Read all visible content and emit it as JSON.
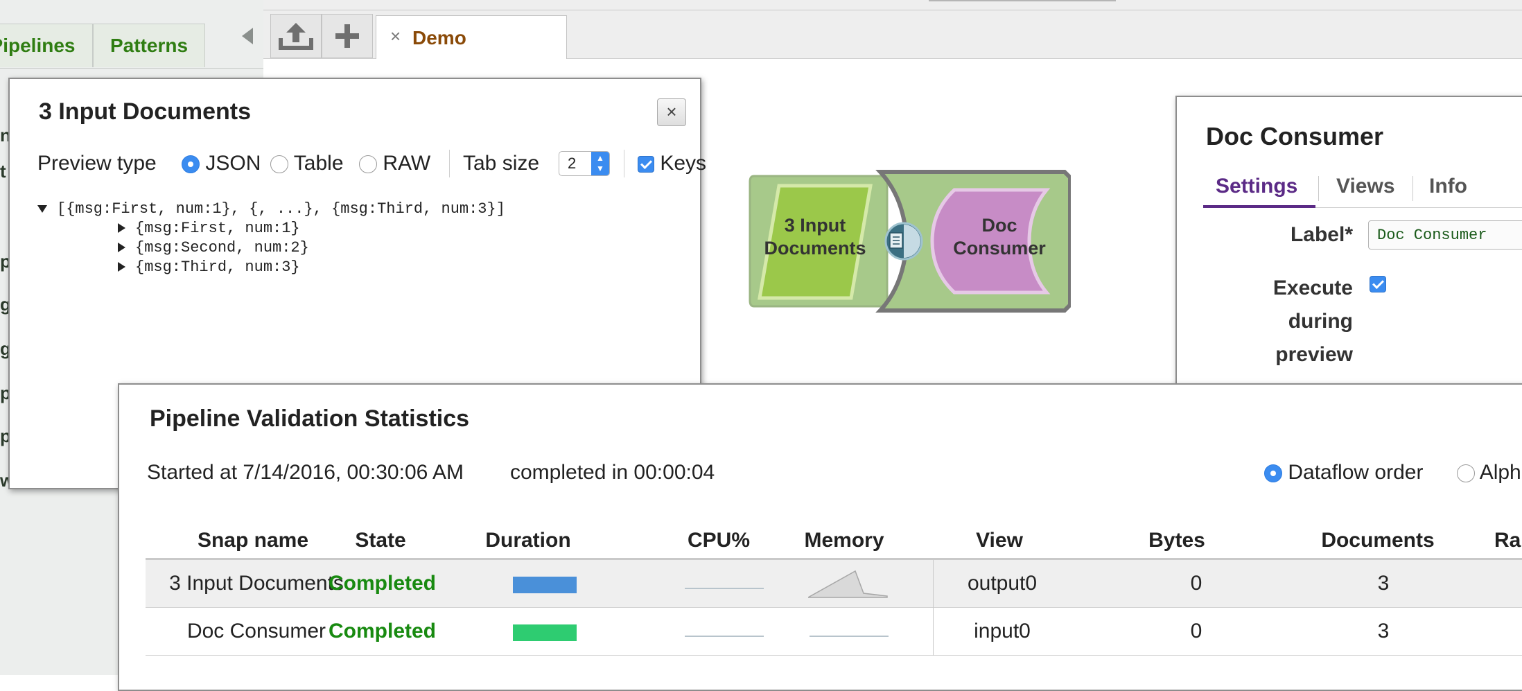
{
  "sidebar": {
    "tabs": [
      {
        "label": "Pipelines"
      },
      {
        "label": "Patterns"
      }
    ],
    "fragments": [
      "n",
      "t",
      "p",
      "g",
      "g",
      "p",
      "p",
      "w"
    ]
  },
  "topbar": {
    "tab_title": "Demo",
    "close_glyph": "×"
  },
  "preview": {
    "title": "3 Input Documents",
    "close_glyph": "×",
    "preview_type_label": "Preview type",
    "options": [
      "JSON",
      "Table",
      "RAW"
    ],
    "selected": "JSON",
    "tab_size_label": "Tab size",
    "tab_size_value": "2",
    "keys_label": "Keys",
    "keys_checked": true,
    "tree_root": "[{msg:First, num:1}, {, ...}, {msg:Third, num:3}]",
    "tree_children": [
      "{msg:First, num:1}",
      "{msg:Second, num:2}",
      "{msg:Third, num:3}"
    ]
  },
  "pipeline": {
    "nodes": [
      {
        "label_line1": "3 Input",
        "label_line2": "Documents",
        "color": "#9bc84a"
      },
      {
        "label_line1": "Doc",
        "label_line2": "Consumer",
        "color": "#c78cc6"
      }
    ]
  },
  "settings": {
    "title": "Doc Consumer",
    "tabs": [
      "Settings",
      "Views",
      "Info"
    ],
    "active_tab": "Settings",
    "label_caption": "Label*",
    "label_value": "Doc Consumer",
    "execute_caption_lines": [
      "Execute",
      "during",
      "preview"
    ],
    "execute_checked": true
  },
  "stats": {
    "title": "Pipeline Validation Statistics",
    "started": "Started at 7/14/2016, 00:30:06 AM",
    "completed": "completed in 00:00:04",
    "order_options": [
      "Dataflow order",
      "Alph"
    ],
    "order_selected": "Dataflow order",
    "columns": [
      "Snap name",
      "State",
      "Duration",
      "CPU%",
      "Memory",
      "View",
      "Bytes",
      "Documents",
      "Ra"
    ],
    "rows": [
      {
        "snap": "3 Input Documents",
        "state": "Completed",
        "duration_color": "#4a90d9",
        "view": "output0",
        "bytes": "0",
        "documents": "3"
      },
      {
        "snap": "Doc Consumer",
        "state": "Completed",
        "duration_color": "#2ecc71",
        "view": "input0",
        "bytes": "0",
        "documents": "3"
      }
    ]
  },
  "colors": {
    "accent_blue": "#3b8cf0",
    "state_green": "#188a10",
    "tab_brown": "#8a4a08",
    "settings_tab_purple": "#5b2a86"
  }
}
